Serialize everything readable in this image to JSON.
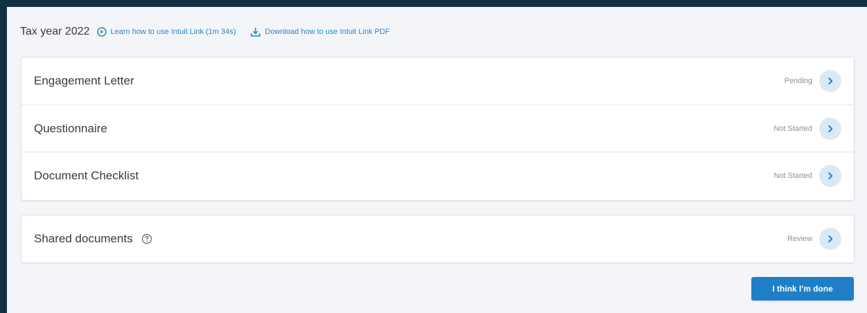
{
  "header": {
    "tax_year_label": "Tax year 2022",
    "learn_link": "Learn how to use Intuit Link (1m 34s)",
    "download_link": "Download how to use Intuit Link PDF"
  },
  "tasks": [
    {
      "label": "Engagement Letter",
      "status": "Pending"
    },
    {
      "label": "Questionnaire",
      "status": "Not Started"
    },
    {
      "label": "Document Checklist",
      "status": "Not Started"
    }
  ],
  "shared": {
    "label": "Shared documents",
    "status": "Review"
  },
  "done_button": "I think I'm done",
  "colors": {
    "background": "#0f3243",
    "panel": "#f4f5f8",
    "link": "#2a86c9",
    "primary_button": "#1f7fc6",
    "chevron_circle": "#dbe9f5"
  },
  "icons": {
    "learn": "play-circle-icon",
    "download": "download-icon",
    "row_action": "chevron-right-icon",
    "help": "help-circle-icon"
  }
}
